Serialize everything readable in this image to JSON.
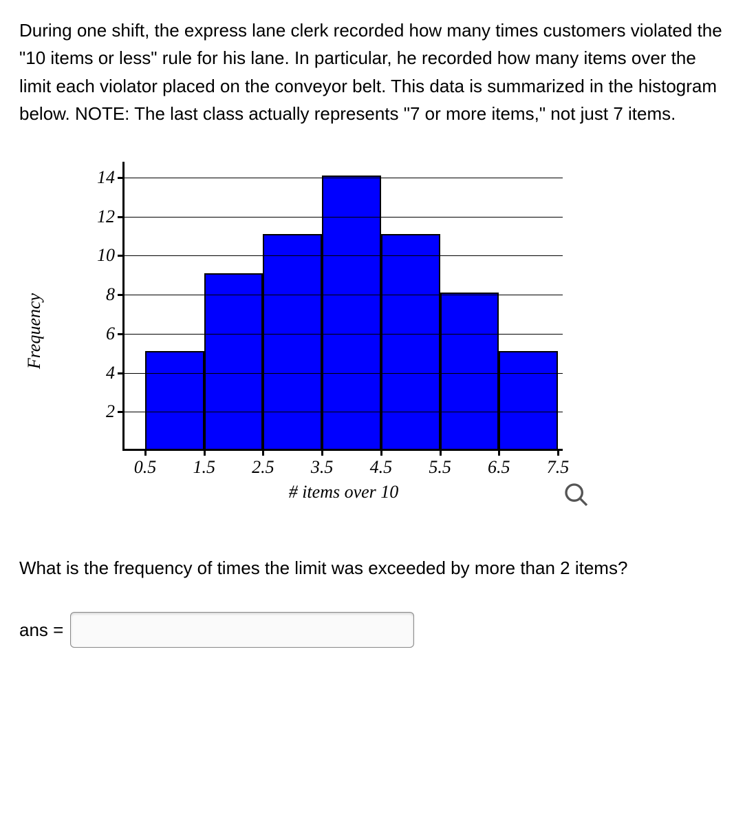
{
  "problem_text": "During one shift, the express lane clerk recorded how many times customers violated the \"10 items or less\" rule for his lane. In particular, he recorded how many items over the limit each violator placed on the conveyor belt. This data is summarized in the histogram below. NOTE: The last class actually represents \"7 or more items,\" not just 7 items.",
  "question_text": "What is the frequency of times the limit was exceeded by more than 2 items?",
  "answer_label": "ans =",
  "answer_value": "",
  "chart_data": {
    "type": "bar",
    "title": "",
    "xlabel": "# items over 10",
    "ylabel": "Frequency",
    "x_tick_labels": [
      "0.5",
      "1.5",
      "2.5",
      "3.5",
      "4.5",
      "5.5",
      "6.5",
      "7.5"
    ],
    "y_tick_labels": [
      "2",
      "4",
      "6",
      "8",
      "10",
      "12",
      "14"
    ],
    "ylim": [
      0,
      14.8
    ],
    "categories": [
      "1",
      "2",
      "3",
      "4",
      "5",
      "6",
      "7"
    ],
    "values": [
      5,
      9,
      11,
      14,
      11,
      8,
      5
    ]
  }
}
